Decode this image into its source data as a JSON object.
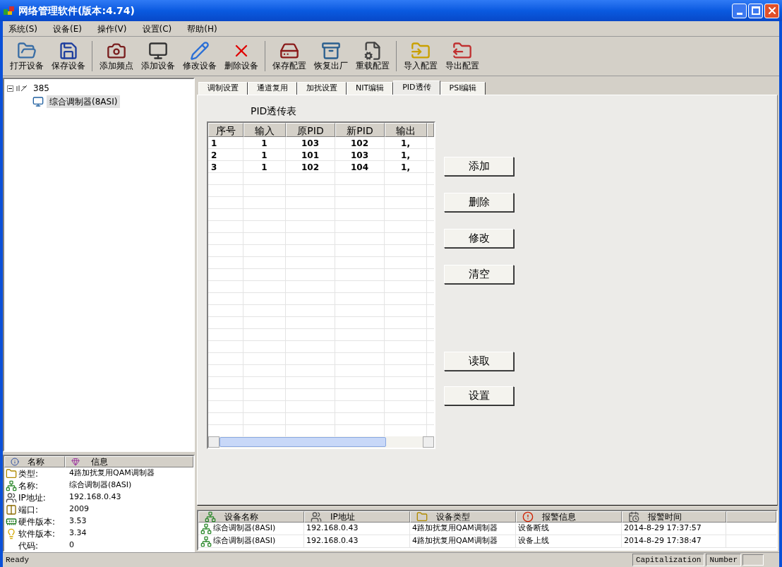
{
  "window": {
    "title": "网络管理软件(版本:4.74)"
  },
  "menu": [
    "系统(S)",
    "设备(E)",
    "操作(V)",
    "设置(C)",
    "帮助(H)"
  ],
  "toolbar": [
    [
      {
        "kind": "open",
        "label": "打开设备"
      },
      {
        "kind": "save",
        "label": "保存设备"
      }
    ],
    [
      {
        "kind": "camera",
        "label": "添加频点"
      },
      {
        "kind": "monitor",
        "label": "添加设备"
      },
      {
        "kind": "edit",
        "label": "修改设备"
      },
      {
        "kind": "delete",
        "label": "删除设备"
      }
    ],
    [
      {
        "kind": "disk",
        "label": "保存配置"
      },
      {
        "kind": "restore",
        "label": "恢复出厂"
      },
      {
        "kind": "reload",
        "label": "重载配置"
      }
    ],
    [
      {
        "kind": "import",
        "label": "导入配置"
      },
      {
        "kind": "export",
        "label": "导出配置"
      }
    ]
  ],
  "tree": [
    {
      "label": "385",
      "expanded": true,
      "selected": false,
      "children": [
        {
          "label": "综合调制器(8ASI)",
          "selected": true
        }
      ]
    }
  ],
  "info": {
    "columns": [
      "名称",
      "信息"
    ],
    "rows": [
      {
        "kind": "folder",
        "name": "类型:",
        "value": "4路加扰复用QAM调制器"
      },
      {
        "kind": "device",
        "name": "名称:",
        "value": "综合调制器(8ASI)"
      },
      {
        "kind": "network",
        "name": "IP地址:",
        "value": "192.168.0.43"
      },
      {
        "kind": "port",
        "name": "端口:",
        "value": "2009"
      },
      {
        "kind": "memory",
        "name": "硬件版本:",
        "value": "3.53"
      },
      {
        "kind": "bulb",
        "name": "软件版本:",
        "value": "3.34"
      },
      {
        "kind": "none",
        "name": "代码:",
        "value": "0"
      }
    ]
  },
  "tabs": [
    {
      "label": "调制设置",
      "selected": false
    },
    {
      "label": "通道复用",
      "selected": false
    },
    {
      "label": "加扰设置",
      "selected": false
    },
    {
      "label": "NIT编辑",
      "selected": false
    },
    {
      "label": "PID透传",
      "selected": true
    },
    {
      "label": "PSI编辑",
      "selected": false
    }
  ],
  "pid_table": {
    "title": "PID透传表",
    "columns": [
      "序号",
      "输入",
      "原PID",
      "新PID",
      "输出"
    ],
    "rows": [
      [
        "1",
        "1",
        "103",
        "102",
        "1,"
      ],
      [
        "2",
        "1",
        "101",
        "103",
        "1,"
      ],
      [
        "3",
        "1",
        "102",
        "104",
        "1,"
      ]
    ]
  },
  "actions_top": [
    "添加",
    "删除",
    "修改",
    "清空"
  ],
  "actions_bottom": [
    "读取",
    "设置"
  ],
  "log": {
    "columns": [
      {
        "kind": "device",
        "label": "设备名称"
      },
      {
        "kind": "network",
        "label": "IP地址"
      },
      {
        "kind": "folder",
        "label": "设备类型"
      },
      {
        "kind": "alarm",
        "label": "报警信息"
      },
      {
        "kind": "clock",
        "label": "报警时间"
      }
    ],
    "rows": [
      [
        "综合调制器(8ASI)",
        "192.168.0.43",
        "4路加扰复用QAM调制器",
        "设备断线",
        "2014-8-29 17:37:57"
      ],
      [
        "综合调制器(8ASI)",
        "192.168.0.43",
        "4路加扰复用QAM调制器",
        "设备上线",
        "2014-8-29 17:38:47"
      ]
    ]
  },
  "status_bar": {
    "message": "Ready",
    "panes": [
      "Capitalization",
      "Number"
    ]
  }
}
